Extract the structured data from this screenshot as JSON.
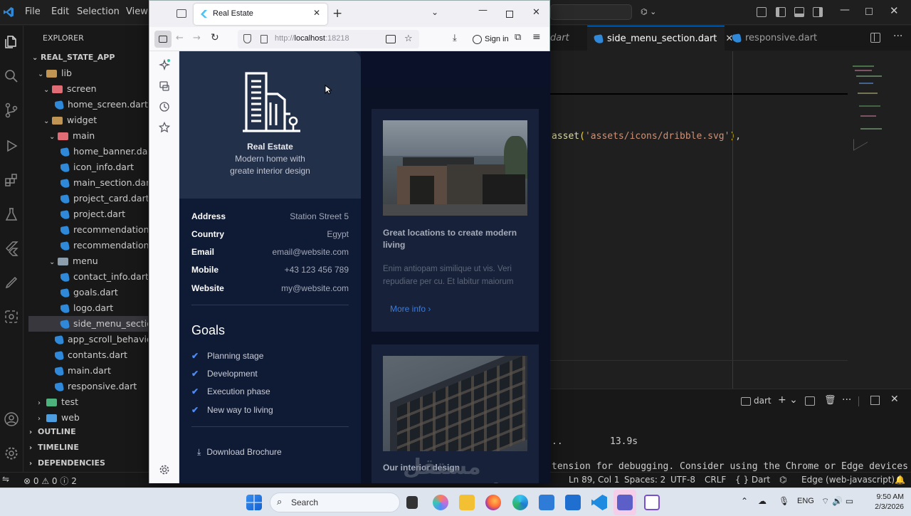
{
  "vscode": {
    "menu": [
      "File",
      "Edit",
      "Selection",
      "View"
    ],
    "explorer_title": "EXPLORER",
    "project": "REAL_STATE_APP",
    "tree": [
      {
        "label": "lib",
        "type": "folder",
        "depth": 1
      },
      {
        "label": "screen",
        "type": "folder",
        "depth": 2
      },
      {
        "label": "home_screen.dart",
        "type": "dart",
        "depth": 3
      },
      {
        "label": "widget",
        "type": "folder",
        "depth": 2
      },
      {
        "label": "main",
        "type": "folder",
        "depth": 3
      },
      {
        "label": "home_banner.dart",
        "type": "dart",
        "depth": 4
      },
      {
        "label": "icon_info.dart",
        "type": "dart",
        "depth": 4
      },
      {
        "label": "main_section.dart",
        "type": "dart",
        "depth": 4
      },
      {
        "label": "project_card.dart",
        "type": "dart",
        "depth": 4
      },
      {
        "label": "project.dart",
        "type": "dart",
        "depth": 4
      },
      {
        "label": "recommendation",
        "type": "dart",
        "depth": 4
      },
      {
        "label": "recommendation",
        "type": "dart",
        "depth": 4
      },
      {
        "label": "menu",
        "type": "folder",
        "depth": 3
      },
      {
        "label": "contact_info.dart",
        "type": "dart",
        "depth": 4
      },
      {
        "label": "goals.dart",
        "type": "dart",
        "depth": 4
      },
      {
        "label": "logo.dart",
        "type": "dart",
        "depth": 4
      },
      {
        "label": "side_menu_section.dart",
        "type": "dart",
        "depth": 4
      },
      {
        "label": "app_scroll_behavior.dart",
        "type": "dart",
        "depth": 3
      },
      {
        "label": "contants.dart",
        "type": "dart",
        "depth": 3
      },
      {
        "label": "main.dart",
        "type": "dart",
        "depth": 3
      },
      {
        "label": "responsive.dart",
        "type": "dart",
        "depth": 3
      },
      {
        "label": "test",
        "type": "folder",
        "depth": 1
      },
      {
        "label": "web",
        "type": "folder",
        "depth": 1
      }
    ],
    "sections": [
      "OUTLINE",
      "TIMELINE",
      "DEPENDENCIES"
    ],
    "tabs": [
      "dart",
      "side_menu_section.dart",
      "responsive.dart"
    ],
    "code_line": "asset('assets/icons/dribble.svg'),",
    "terminal_label": "dart",
    "terminal_time": "13.9s",
    "terminal_ellipsis": "..",
    "terminal_msg": "tension for debugging. Consider using the Chrome or Edge devices fo",
    "status": {
      "errors": "0",
      "warnings": "0",
      "info": "2",
      "ln_col": "Ln 89, Col 1",
      "spaces": "Spaces: 2",
      "encoding": "UTF-8",
      "eol": "CRLF",
      "lang": "{ } Dart",
      "device": "Edge (web-javascript)"
    }
  },
  "browser": {
    "tab_title": "Real Estate",
    "url_prefix": "http://",
    "url_host": "localhost",
    "url_port": ":18218",
    "sign_in": "Sign in"
  },
  "site": {
    "brand": "Real Estate",
    "tagline_1": "Modern home with",
    "tagline_2": "greate interior design",
    "info": [
      {
        "key": "Address",
        "value": "Station Street 5"
      },
      {
        "key": "Country",
        "value": "Egypt"
      },
      {
        "key": "Email",
        "value": "email@website.com"
      },
      {
        "key": "Mobile",
        "value": "+43 123 456 789"
      },
      {
        "key": "Website",
        "value": "my@website.com"
      }
    ],
    "goals_title": "Goals",
    "goals": [
      "Planning stage",
      "Development",
      "Execution phase",
      "New way to living"
    ],
    "download": "Download Brochure",
    "card1": {
      "title": "Great locations to create modern living",
      "text": "Enim antiopam similique ut vis. Veri repudiare per cu. Et labitur maiorum",
      "more": "More info ›"
    },
    "card2": {
      "title": "Our interior design"
    }
  },
  "taskbar": {
    "search": "Search",
    "lang": "ENG",
    "time": "9:50 AM",
    "date": "2/3/2026"
  },
  "watermark": "مستقل mostaql.com"
}
